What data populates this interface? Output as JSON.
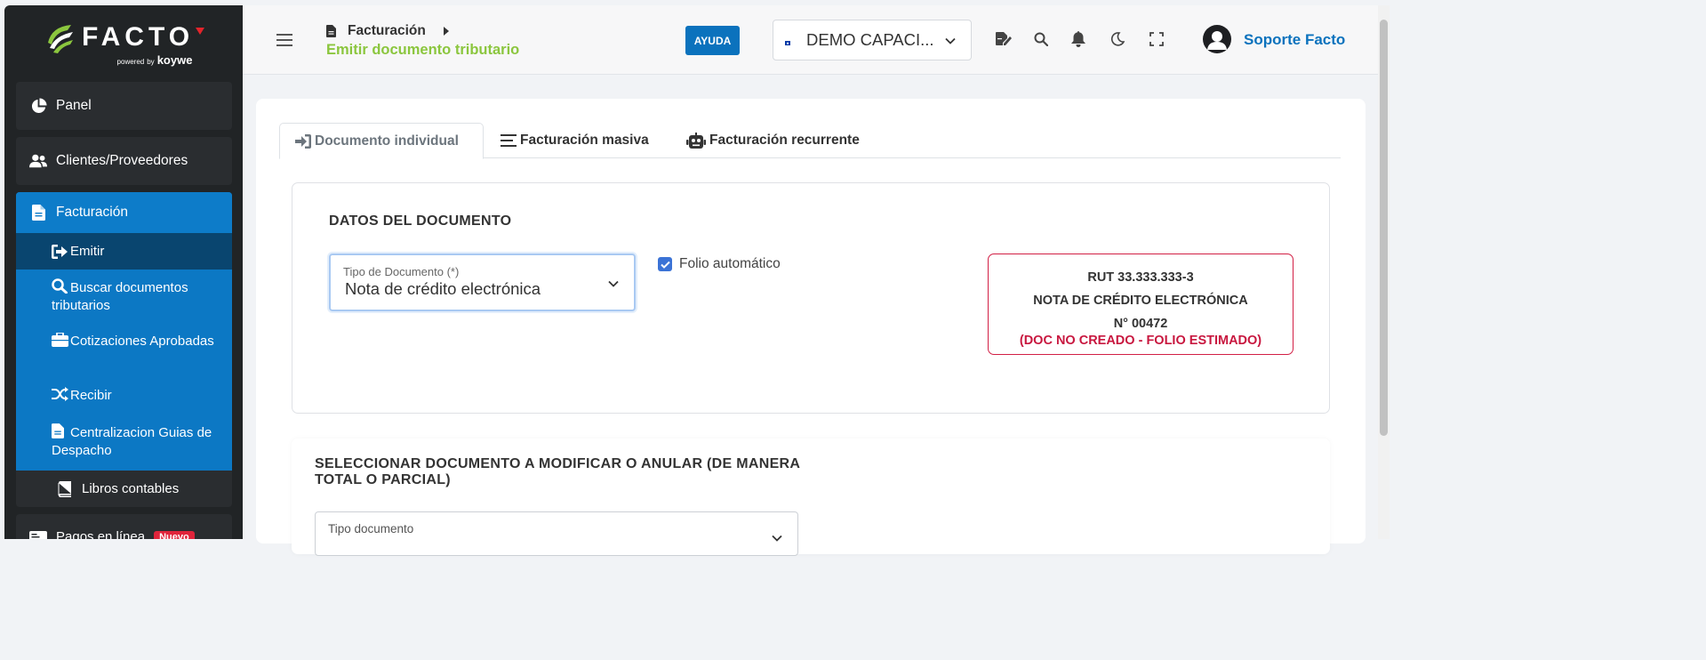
{
  "sidebar": {
    "logo": {
      "brand": "FACTO",
      "powered": "powered",
      "by": "by",
      "company": "koywe"
    },
    "items": [
      {
        "label": "Panel"
      },
      {
        "label": "Clientes/Proveedores"
      }
    ],
    "facturacion": {
      "label": "Facturación",
      "subitems": [
        {
          "label": "Emitir"
        },
        {
          "label": "Buscar documentos tributarios"
        },
        {
          "label": "Cotizaciones Aprobadas"
        },
        {
          "label": "Recibir"
        },
        {
          "label": "Centralizacion Guias de Despacho"
        }
      ]
    },
    "libros": {
      "label": "Libros contables"
    },
    "pagos": {
      "label": "Pagos en línea",
      "badge": "Nuevo"
    }
  },
  "topbar": {
    "breadcrumb": "Facturación",
    "page_title": "Emitir documento tributario",
    "help_label": "AYUDA",
    "company": "DEMO CAPACI...",
    "user_name": "Soporte Facto"
  },
  "tabs": [
    {
      "label": "Documento individual"
    },
    {
      "label": "Facturación masiva"
    },
    {
      "label": "Facturación recurrente"
    }
  ],
  "datos": {
    "title": "DATOS DEL DOCUMENTO",
    "tipo_label": "Tipo de Documento (*)",
    "tipo_value": "Nota de crédito electrónica",
    "folio_label": "Folio automático",
    "folio_box": {
      "rut": "RUT 33.333.333-3",
      "doc_type": "NOTA DE CRÉDITO ELECTRÓNICA",
      "number": "N° 00472",
      "status": "(DOC NO CREADO - FOLIO ESTIMADO)"
    }
  },
  "seleccionar": {
    "title": "SELECCIONAR DOCUMENTO A MODIFICAR O ANULAR (DE MANERA TOTAL O PARCIAL)",
    "tipo_doc_label": "Tipo documento"
  },
  "colors": {
    "accent": "#0b72bd",
    "green": "#8bc63e",
    "sidebar_bg": "#212426",
    "danger": "#c8173f"
  }
}
